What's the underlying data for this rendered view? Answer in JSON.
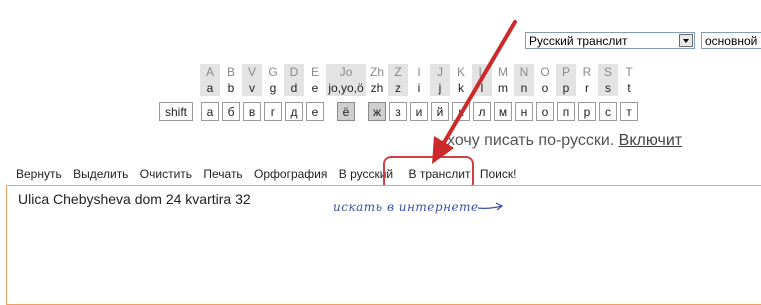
{
  "selects": {
    "layout": "Русский транслит",
    "variant": "основной"
  },
  "keyboard": {
    "columns": [
      {
        "upper": "A",
        "lower": "a",
        "shaded": true
      },
      {
        "upper": "B",
        "lower": "b",
        "shaded": false
      },
      {
        "upper": "V",
        "lower": "v",
        "shaded": true
      },
      {
        "upper": "G",
        "lower": "g",
        "shaded": false
      },
      {
        "upper": "D",
        "lower": "d",
        "shaded": true
      },
      {
        "upper": "E",
        "lower": "e",
        "shaded": false
      },
      {
        "upper": "Jo",
        "lower": "jo,yo,ö",
        "shaded": true
      },
      {
        "upper": "Zh",
        "lower": "zh",
        "shaded": false
      },
      {
        "upper": "Z",
        "lower": "z",
        "shaded": true
      },
      {
        "upper": "I",
        "lower": "i",
        "shaded": false
      },
      {
        "upper": "J",
        "lower": "j",
        "shaded": true
      },
      {
        "upper": "K",
        "lower": "k",
        "shaded": false
      },
      {
        "upper": "L",
        "lower": "l",
        "shaded": true
      },
      {
        "upper": "M",
        "lower": "m",
        "shaded": false
      },
      {
        "upper": "N",
        "lower": "n",
        "shaded": true
      },
      {
        "upper": "O",
        "lower": "o",
        "shaded": false
      },
      {
        "upper": "P",
        "lower": "p",
        "shaded": true
      },
      {
        "upper": "R",
        "lower": "r",
        "shaded": false
      },
      {
        "upper": "S",
        "lower": "s",
        "shaded": true
      },
      {
        "upper": "T",
        "lower": "t",
        "shaded": false
      }
    ],
    "shift": "shift",
    "keys": [
      "а",
      "б",
      "в",
      "г",
      "д",
      "е",
      "ё",
      "ж",
      "з",
      "и",
      "й",
      "к",
      "л",
      "м",
      "н",
      "о",
      "п",
      "р",
      "с",
      "т"
    ]
  },
  "hint": {
    "text": "хочу писать по-русски.",
    "link": "Включит"
  },
  "toolbar": {
    "items": [
      "Вернуть",
      "Выделить",
      "Очистить",
      "Печать",
      "Орфография",
      "В русский",
      "В транслит",
      "Поиск!"
    ]
  },
  "editor": {
    "value": "Ulica Chebysheva dom 24 kvartira 32"
  },
  "annotation": {
    "note": "искать в интернете"
  }
}
